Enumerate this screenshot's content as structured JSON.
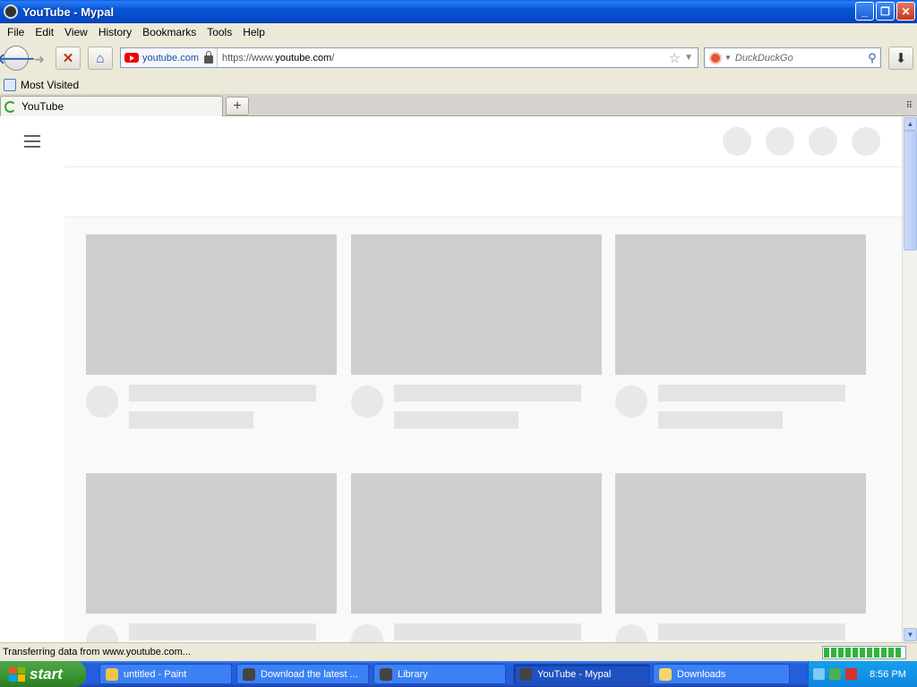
{
  "window": {
    "title": "YouTube - Mypal"
  },
  "menu": [
    "File",
    "Edit",
    "View",
    "History",
    "Bookmarks",
    "Tools",
    "Help"
  ],
  "navbar": {
    "identity_domain": "youtube.com",
    "url_prefix": "https://www.",
    "url_host": "youtube.com",
    "url_suffix": "/",
    "search_placeholder": "DuckDuckGo"
  },
  "bookmarks": {
    "most_visited": "Most Visited"
  },
  "tabs": [
    {
      "label": "YouTube"
    }
  ],
  "status": {
    "text": "Transferring data from www.youtube.com...",
    "progress": 1.0
  },
  "taskbar": {
    "start_label": "start",
    "tasks": [
      {
        "label": "untitled - Paint"
      },
      {
        "label": "Download the latest ..."
      },
      {
        "label": "Library"
      },
      {
        "label": "YouTube - Mypal"
      },
      {
        "label": "Downloads"
      }
    ],
    "clock": "8:56 PM"
  },
  "colors": {
    "titlebar": "#0854d8",
    "taskbar": "#245edb",
    "skeleton": "#cecece",
    "progress": "#31b43a"
  }
}
